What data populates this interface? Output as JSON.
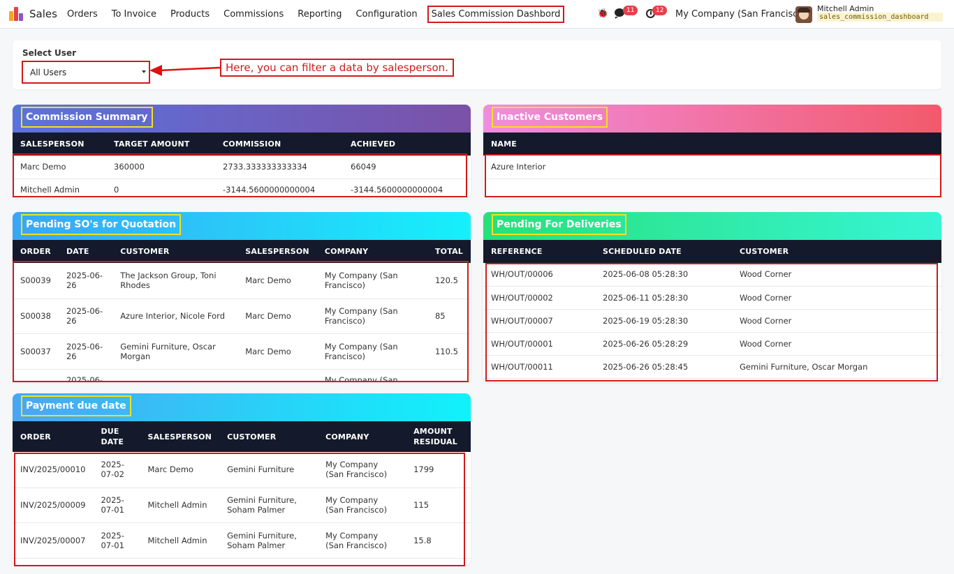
{
  "navbar": {
    "app_name": "Sales",
    "menu": [
      "Orders",
      "To Invoice",
      "Products",
      "Commissions",
      "Reporting",
      "Configuration",
      "Sales Commission Dashbord"
    ],
    "chat_count": "11",
    "activity_count": "12",
    "company": "My Company (San Francisco)",
    "user": "Mitchell Admin",
    "database": "sales_commission_dashboard"
  },
  "filter": {
    "label": "Select User",
    "value": "All Users",
    "annotation": "Here, you can filter a data by salesperson."
  },
  "commission_summary": {
    "title": "Commission Summary",
    "columns": [
      "SALESPERSON",
      "TARGET AMOUNT",
      "COMMISSION",
      "ACHIEVED"
    ],
    "rows": [
      [
        "Marc Demo",
        "360000",
        "2733.333333333334",
        "66049"
      ],
      [
        "Mitchell Admin",
        "0",
        "-3144.5600000000004",
        "-3144.5600000000004"
      ]
    ]
  },
  "inactive_customers": {
    "title": "Inactive Customers",
    "columns": [
      "NAME"
    ],
    "rows": [
      [
        "Azure Interior"
      ]
    ]
  },
  "pending_so": {
    "title": "Pending SO's for Quotation",
    "columns": [
      "ORDER",
      "DATE",
      "CUSTOMER",
      "SALESPERSON",
      "COMPANY",
      "TOTAL"
    ],
    "rows": [
      [
        "S00039",
        "2025-06-26",
        "The Jackson Group, Toni Rhodes",
        "Marc Demo",
        "My Company (San Francisco)",
        "120.5"
      ],
      [
        "S00038",
        "2025-06-26",
        "Azure Interior, Nicole Ford",
        "Marc Demo",
        "My Company (San Francisco)",
        "85"
      ],
      [
        "S00037",
        "2025-06-26",
        "Gemini Furniture, Oscar Morgan",
        "Marc Demo",
        "My Company (San Francisco)",
        "110.5"
      ],
      [
        "",
        "2025-06-",
        "",
        "",
        "My Company (San",
        ""
      ]
    ]
  },
  "pending_deliveries": {
    "title": "Pending For Deliveries",
    "columns": [
      "REFERENCE",
      "SCHEDULED DATE",
      "CUSTOMER"
    ],
    "rows": [
      [
        "WH/OUT/00006",
        "2025-06-08 05:28:30",
        "Wood Corner"
      ],
      [
        "WH/OUT/00002",
        "2025-06-11 05:28:30",
        "Wood Corner"
      ],
      [
        "WH/OUT/00007",
        "2025-06-19 05:28:30",
        "Wood Corner"
      ],
      [
        "WH/OUT/00001",
        "2025-06-26 05:28:29",
        "Wood Corner"
      ],
      [
        "WH/OUT/00011",
        "2025-06-26 05:28:45",
        "Gemini Furniture, Oscar Morgan"
      ]
    ]
  },
  "payment_due": {
    "title": "Payment due date",
    "columns": [
      "ORDER",
      "DUE DATE",
      "SALESPERSON",
      "CUSTOMER",
      "COMPANY",
      "AMOUNT RESIDUAL"
    ],
    "rows": [
      [
        "INV/2025/00010",
        "2025-07-02",
        "Marc Demo",
        "Gemini Furniture",
        "My Company (San Francisco)",
        "1799"
      ],
      [
        "INV/2025/00009",
        "2025-07-01",
        "Mitchell Admin",
        "Gemini Furniture, Soham Palmer",
        "My Company (San Francisco)",
        "115"
      ],
      [
        "INV/2025/00007",
        "2025-07-01",
        "Mitchell Admin",
        "Gemini Furniture, Soham Palmer",
        "My Company (San Francisco)",
        "15.8"
      ]
    ]
  },
  "colors": {
    "highlight_red": "#d21a1a",
    "title_outline_yellow": "#f3e21c",
    "table_header": "#141a2b"
  }
}
